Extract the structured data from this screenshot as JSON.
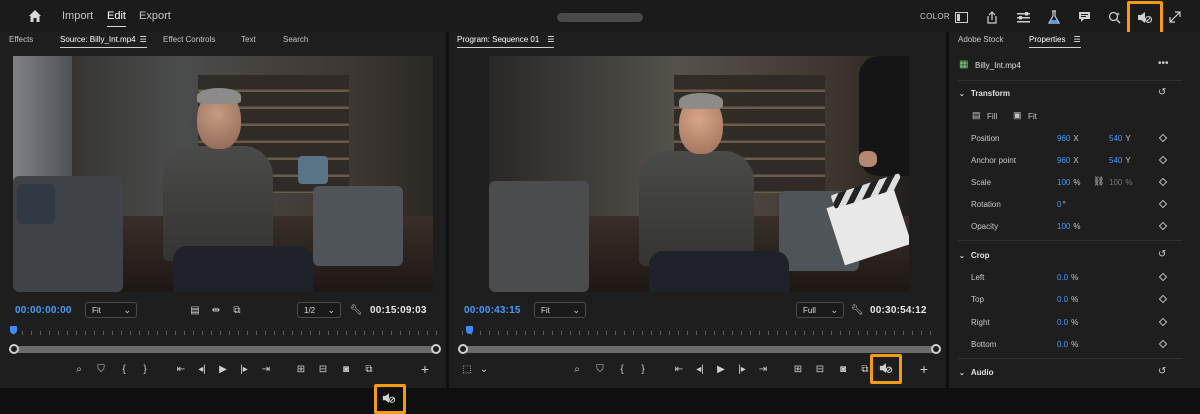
{
  "topbar": {
    "menus": [
      "Import",
      "Edit",
      "Export"
    ],
    "active_menu": "Edit",
    "color_label": "COLOR",
    "icons": [
      "home-icon",
      "color-panel-icon",
      "share-icon",
      "list-icon",
      "flask-icon",
      "comment-icon",
      "search-sparkle-icon",
      "audio-mute-icon",
      "fullscreen-icon"
    ]
  },
  "source_panel": {
    "tabs": [
      "Effects",
      "Source: Billy_Int.mp4",
      "Effect Controls",
      "Text",
      "Search"
    ],
    "active_tab": "Source: Billy_Int.mp4",
    "timecode_in": "00:00:00:00",
    "zoom": "Fit",
    "resolution": "1/2",
    "duration": "00:15:09:03"
  },
  "program_panel": {
    "tab": "Program: Sequence 01",
    "timecode_in": "00:00:43:15",
    "zoom": "Fit",
    "resolution": "Full",
    "duration": "00:30:54:12"
  },
  "properties_panel": {
    "tabs": [
      "Adobe Stock",
      "Properties"
    ],
    "active_tab": "Properties",
    "clip_name": "Billy_Int.mp4",
    "sections": {
      "transform": {
        "title": "Transform",
        "fill": "Fill",
        "fit": "Fit",
        "rows": [
          {
            "label": "Position",
            "v1": "960",
            "u1": "X",
            "v2": "540",
            "u2": "Y"
          },
          {
            "label": "Anchor point",
            "v1": "960",
            "u1": "X",
            "v2": "540",
            "u2": "Y"
          },
          {
            "label": "Scale",
            "v1": "100",
            "u1": "%",
            "v2": "100",
            "u2": "%"
          },
          {
            "label": "Rotation",
            "v1": "0",
            "u1": "°"
          },
          {
            "label": "Opacity",
            "v1": "100",
            "u1": "%"
          }
        ]
      },
      "crop": {
        "title": "Crop",
        "rows": [
          {
            "label": "Left",
            "v1": "0.0",
            "u1": "%"
          },
          {
            "label": "Top",
            "v1": "0.0",
            "u1": "%"
          },
          {
            "label": "Right",
            "v1": "0.0",
            "u1": "%"
          },
          {
            "label": "Bottom",
            "v1": "0.0",
            "u1": "%"
          }
        ]
      },
      "audio": {
        "title": "Audio"
      }
    }
  },
  "colors": {
    "accent_blue": "#4a9aff",
    "highlight_orange": "#f39c12"
  }
}
